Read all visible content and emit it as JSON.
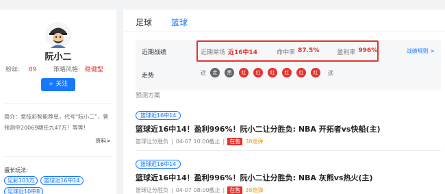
{
  "profile": {
    "name": "阮小二",
    "fans_label": "粉丝:",
    "fans_value": "89",
    "style_label": "策略风格:",
    "style_value": "稳健型",
    "follow_label": "+ 关注",
    "intro": "简介：竞技彩智能荐单，代号“阮小二”，曾预测中20069期任九47万！等等！",
    "more_label": "资料>",
    "good_at_title": "擅长玩法:",
    "tags": [
      "足彩103万",
      "篮球近16中14",
      "足球近10中8"
    ]
  },
  "tabs": [
    {
      "label": "足球"
    },
    {
      "label": "篮球"
    }
  ],
  "record": {
    "recent_label": "近期战绩",
    "trend_label": "走势",
    "single_label": "近期单场",
    "single_value": "近16中14",
    "hit_label": "命中率",
    "hit_value": "87.5%",
    "profit_label": "盈利率",
    "profit_value": "996%",
    "rules_link": "战绩规则 >",
    "trend_start": "近",
    "trend_end": "远",
    "trend": [
      {
        "label": "走",
        "result": "other"
      },
      {
        "label": "黑",
        "result": "other"
      },
      {
        "label": "红",
        "result": "win"
      },
      {
        "label": "红",
        "result": "win"
      },
      {
        "label": "红",
        "result": "win"
      },
      {
        "label": "红",
        "result": "win"
      },
      {
        "label": "红",
        "result": "win"
      },
      {
        "label": "红",
        "result": "win"
      }
    ]
  },
  "plans_title": "预测方案",
  "plans": [
    {
      "tag": "篮球近16中14",
      "title": "篮球近16中14！盈利996%！阮小二让分胜负: NBA 开拓者vs快船(主)",
      "type": "篮球让分胜负",
      "deadline": "04-07 10:00截止",
      "status": "在售",
      "price": "38熄弹"
    },
    {
      "tag": "篮球近16中14",
      "title": "篮球近16中14！盈利996%！阮小二让分胜负: NBA 灰熊vs热火(主)",
      "type": "篮球让分胜负",
      "deadline": "04-07 08:00截止",
      "status": "在售",
      "price": "38熄弹"
    }
  ],
  "colors": {
    "accent": "#1677ff",
    "red": "#e5322b",
    "coin": "#f39800"
  }
}
